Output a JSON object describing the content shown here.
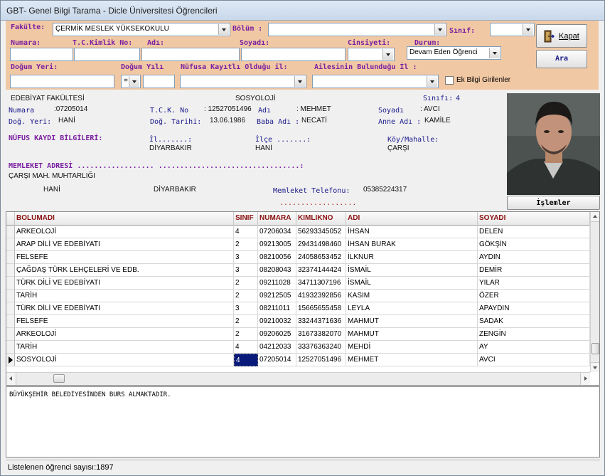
{
  "window": {
    "title": "GBT- Genel Bilgi Tarama - Dicle Üniversitesi Öğrencileri"
  },
  "search": {
    "fakulte_label": "Fakülte:",
    "fakulte_value": "ÇERMİK  MESLEK YÜKSEKOKULU",
    "bolum_label": "Bölüm :",
    "bolum_value": "",
    "sinif_label": "Sınıf:",
    "sinif_value": "",
    "numara_label": "Numara:",
    "tckimlik_label": "T.C.Kimlik No:",
    "adi_label": "Adı:",
    "soyadi_label": "Soyadı:",
    "cinsiyet_label": "Cinsiyeti:",
    "durum_label": "Durum:",
    "durum_value": "Devam Eden Öğrenci",
    "dogum_yeri_label": "Doğum Yeri:",
    "dogum_yili_label": "Doğum Yılı",
    "dogum_yili_op": "=",
    "nufus_il_label": "Nüfusa Kayıtlı Olduğu il:",
    "aile_il_label": "Ailesinin Bulunduğu İl :",
    "ek_bilgi_label": "Ek Bilgi Girilenler",
    "kapat_label": "Kapat",
    "ara_label": "Ara"
  },
  "info": {
    "fakulte": "EDEBİYAT FAKÜLTESİ",
    "bolum": "SOSYOLOJİ",
    "sinif_label": "Sınıfı:",
    "sinif": "4",
    "numara_label": "Numara",
    "numara": ":07205014",
    "tck_label": "T.C.K. No",
    "tck": ": 12527051496",
    "adi_label": "Adı",
    "adi": ": MEHMET",
    "soyadi_label": "Soyadı",
    "soyadi": ": AVCI",
    "dyeri_label": "Doğ. Yeri:",
    "dyeri": "HANİ",
    "dtarihi_label": "Doğ. Tarihi:",
    "dtarihi": "13.06.1986",
    "baba_label": "Baba Adı :",
    "baba": "NECATİ",
    "anne_label": "Anne Adı :",
    "anne": "KAMİLE",
    "nufus_title": "NÜFUS KAYDI BİLGİLERİ:",
    "il_label": "İl.......:",
    "il": "DİYARBAKIR",
    "ilce_label": "İlçe .......:",
    "ilce": "HANİ",
    "koy_label": "Köy/Mahalle:",
    "koy": "ÇARŞI",
    "adres_title": "MEMLEKET ADRESİ  .................. .................................:",
    "adres_line1": "ÇARŞI MAH. MUHTARLIĞI",
    "adres_ilce": "HANİ",
    "adres_il": "DİYARBAKIR",
    "tel_label": "Memleket Telefonu:",
    "tel": "05385224317",
    "dots": "..................",
    "islemler_label": "İşlemler"
  },
  "grid": {
    "columns": [
      "BOLUMADI",
      "SINIF",
      "NUMARA",
      "KIMLIKNO",
      "ADI",
      "SOYADI"
    ],
    "rows": [
      [
        "ARKEOLOJİ",
        "4",
        "07206034",
        "56293345052",
        "İHSAN",
        "DELEN"
      ],
      [
        "ARAP DİLİ VE EDEBİYATI",
        "2",
        "09213005",
        "29431498460",
        "İHSAN BURAK",
        "GÖKŞİN"
      ],
      [
        "FELSEFE",
        "3",
        "08210056",
        "24058653452",
        "İLKNUR",
        "AYDIN"
      ],
      [
        "ÇAĞDAŞ TÜRK LEHÇELERİ VE EDB.",
        "3",
        "08208043",
        "32374144424",
        "İSMAİL",
        "DEMİR"
      ],
      [
        "TÜRK DİLİ VE EDEBİYATI",
        "2",
        "09211028",
        "34711307196",
        "İSMAİL",
        "YILAR"
      ],
      [
        "TARİH",
        "2",
        "09212505",
        "41932392856",
        "KASIM",
        "ÖZER"
      ],
      [
        "TÜRK DİLİ VE EDEBİYATI",
        "3",
        "08211011",
        "15665655458",
        "LEYLA",
        "APAYDIN"
      ],
      [
        "FELSEFE",
        "2",
        "09210032",
        "33244371636",
        "MAHMUT",
        "SADAK"
      ],
      [
        "ARKEOLOJİ",
        "2",
        "09206025",
        "31673382070",
        "MAHMUT",
        "ZENGİN"
      ],
      [
        "TARİH",
        "4",
        "04212033",
        "33376363240",
        "MEHDİ",
        "AY"
      ],
      [
        "SOSYOLOJİ",
        "4",
        "07205014",
        "12527051496",
        "MEHMET",
        "AVCI"
      ]
    ],
    "selected_row": 10
  },
  "notes": {
    "text": "BÜYÜKŞEHİR BELEDİYESİNDEN  BURS ALMAKTADIR."
  },
  "status": {
    "text": "Listelenen öğrenci sayısı:1897"
  }
}
